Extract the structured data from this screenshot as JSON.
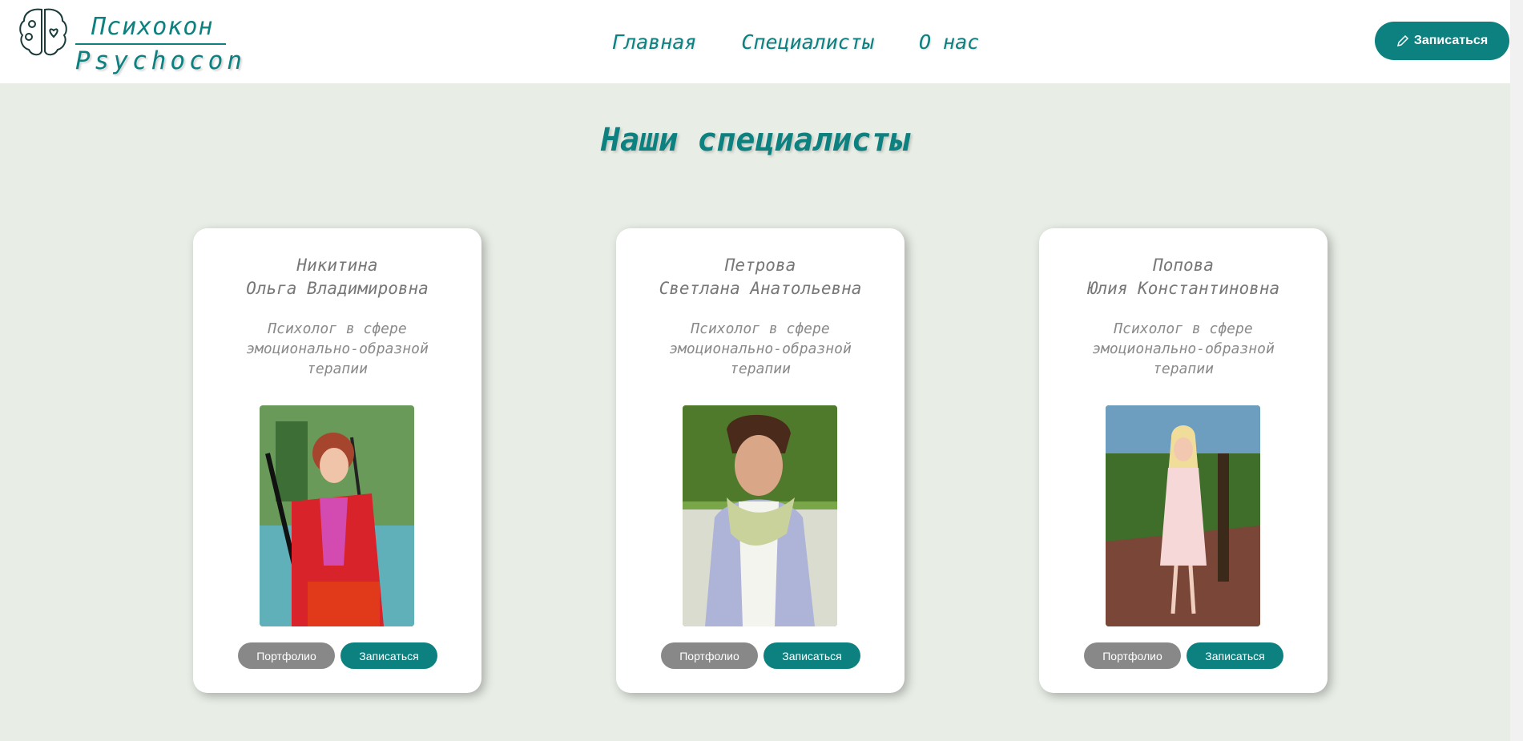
{
  "brand": {
    "name_ru": "Психокон",
    "name_en": "Psychocon",
    "accent_color": "#0d8080"
  },
  "nav": {
    "items": [
      "Главная",
      "Специалисты",
      "О нас"
    ]
  },
  "header": {
    "cta_label": "Записаться",
    "cta_icon": "pencil-icon"
  },
  "section": {
    "title": "Наши специалисты"
  },
  "specialists": [
    {
      "surname": "Никитина",
      "name": "Ольга Владимировна",
      "role_lines": [
        "Психолог в сфере",
        "эмоционально-образной",
        "терапии"
      ],
      "portfolio_label": "Портфолио",
      "enroll_label": "Записаться"
    },
    {
      "surname": "Петрова",
      "name": "Светлана Анатольевна",
      "role_lines": [
        "Психолог в сфере",
        "эмоционально-образной",
        "терапии"
      ],
      "portfolio_label": "Портфолио",
      "enroll_label": "Записаться"
    },
    {
      "surname": "Попова",
      "name": "Юлия Константиновна",
      "role_lines": [
        "Психолог в сфере",
        "эмоционально-образной",
        "терапии"
      ],
      "portfolio_label": "Портфолио",
      "enroll_label": "Записаться"
    }
  ]
}
